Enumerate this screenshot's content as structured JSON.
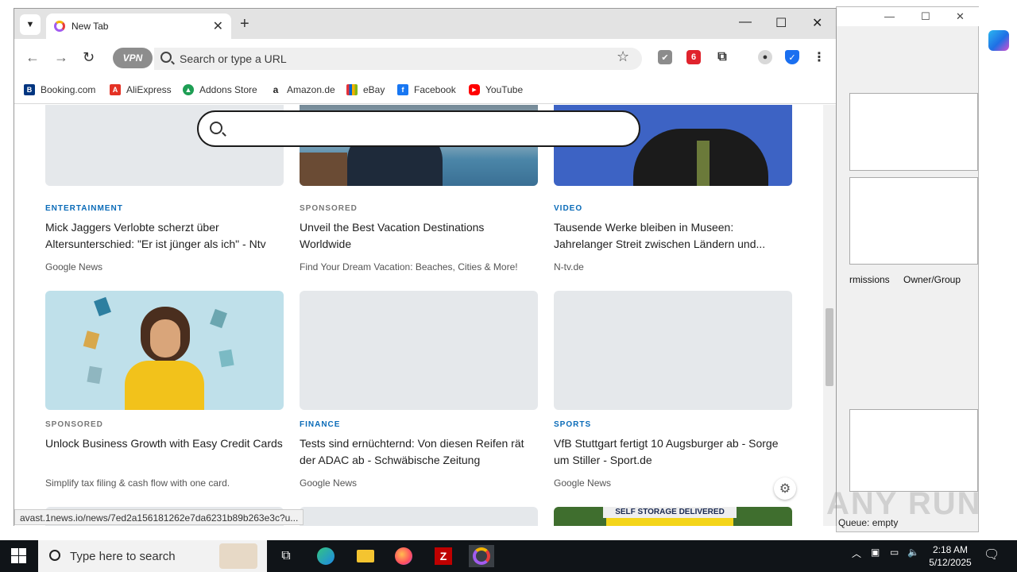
{
  "background_app": {
    "columns": [
      "rmissions",
      "Owner/Group"
    ],
    "queue_status": "Queue: empty"
  },
  "watermark": "ANY RUN",
  "browser": {
    "tab": {
      "title": "New Tab"
    },
    "omnibox": {
      "placeholder": "Search or type a URL",
      "vpn_label": "VPN"
    },
    "bookmarks": [
      {
        "label": "Booking.com",
        "icon": "booking-icon",
        "color": "#003580"
      },
      {
        "label": "AliExpress",
        "icon": "aliexpress-icon",
        "color": "#e43225"
      },
      {
        "label": "Addons Store",
        "icon": "addons-store-icon",
        "color": "#1e9e54"
      },
      {
        "label": "Amazon.de",
        "icon": "amazon-icon",
        "color": "#222222"
      },
      {
        "label": "eBay",
        "icon": "ebay-icon",
        "color": "#e53238"
      },
      {
        "label": "Facebook",
        "icon": "facebook-icon",
        "color": "#1877f2"
      },
      {
        "label": "YouTube",
        "icon": "youtube-icon",
        "color": "#ff0000"
      }
    ],
    "status_url": "avast.1news.io/news/7ed2a156181262e7da6231b89b263e3c?u...",
    "feed": {
      "row1": [
        {
          "category": "ENTERTAINMENT",
          "headline": "Mick Jaggers Verlobte scherzt über Altersunterschied: \"Er ist jünger als ich\" - Ntv",
          "source": "Google News"
        },
        {
          "category": "SPONSORED",
          "headline": "Unveil the Best Vacation Destinations Worldwide",
          "source": "Find Your Dream Vacation: Beaches, Cities & More!"
        },
        {
          "category": "VIDEO",
          "headline": "Tausende Werke bleiben in Museen: Jahrelanger Streit zwischen Ländern und...",
          "source": "N-tv.de"
        }
      ],
      "row2": [
        {
          "category": "SPONSORED",
          "headline": "Unlock Business Growth with Easy Credit Cards",
          "source": "Simplify tax filing & cash flow with one card."
        },
        {
          "category": "FINANCE",
          "headline": "Tests sind ernüchternd: Von diesen Reifen rät der ADAC ab - Schwäbische Zeitung",
          "source": "Google News"
        },
        {
          "category": "SPORTS",
          "headline": "VfB Stuttgart fertigt 10 Augsburger ab - Sorge um Stiller - Sport.de",
          "source": "Google News"
        }
      ],
      "row3_ad_text": "SELF STORAGE DELIVERED"
    }
  },
  "taskbar": {
    "search_placeholder": "Type here to search",
    "time": "2:18 AM",
    "date": "5/12/2025"
  }
}
